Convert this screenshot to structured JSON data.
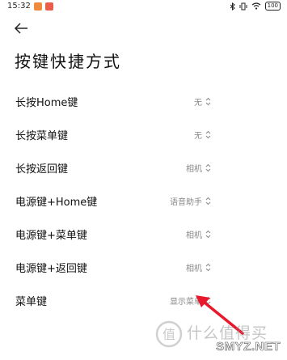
{
  "status_bar": {
    "time": "15:32",
    "battery": "100",
    "badge_colors": [
      "#f08a3c",
      "#e95d4a"
    ]
  },
  "header": {
    "back_icon": "arrow-left-icon",
    "title": "按键快捷方式"
  },
  "settings": [
    {
      "label": "长按Home键",
      "value": "无"
    },
    {
      "label": "长按菜单键",
      "value": "无"
    },
    {
      "label": "长按返回键",
      "value": "相机"
    },
    {
      "label": "电源键+Home键",
      "value": "语音助手"
    },
    {
      "label": "电源键+菜单键",
      "value": "相机"
    },
    {
      "label": "电源键+返回键",
      "value": "相机"
    },
    {
      "label": "菜单键",
      "value": "显示菜单"
    }
  ],
  "annotation": {
    "color": "#e8192c",
    "icon": "red-arrow"
  },
  "watermark": {
    "text": "什么值得买",
    "site": "SMYZ.NET"
  }
}
